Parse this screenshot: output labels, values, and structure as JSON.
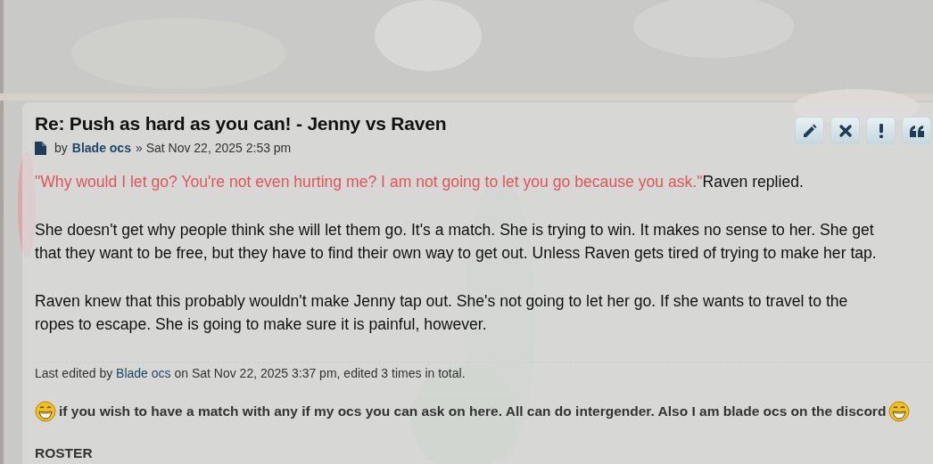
{
  "post": {
    "title": "Re: Push as hard as you can! - Jenny vs Raven",
    "meta": {
      "by": "by",
      "author": "Blade ocs",
      "sep": "»",
      "date": "Sat Nov 22, 2025 2:53 pm"
    },
    "actions": [
      {
        "kind": "edit"
      },
      {
        "kind": "delete"
      },
      {
        "kind": "report"
      },
      {
        "kind": "quote"
      }
    ],
    "quote": {
      "speech": "\"Why would I let go? You're not even hurting me? I am not going to let you go because you ask.\"",
      "after": "Raven replied."
    },
    "paragraphs": [
      {
        "lines": [
          "She doesn't get why people think she will let them go. It's a match. She is trying to win. It makes no sense to her. She get",
          "that they want to be free, but they have to find their own way to get out. Unless Raven gets tired of trying to make her tap."
        ]
      },
      {
        "lines": [
          "Raven knew that this probably wouldn't make Jenny tap out. She's not going to let her go. If she wants to travel to the",
          "ropes to escape. She is going to make sure it is painful, however."
        ]
      }
    ],
    "edited": {
      "prefix": "Last edited by",
      "author": "Blade ocs",
      "suffix": "on Sat Nov 22, 2025 3:37 pm, edited 3 times in total."
    },
    "signature": {
      "text": "if you wish to have a match with any if my ocs you can ask on here. All can do intergender. Also I am blade ocs on the discord",
      "heading": "ROSTER"
    }
  }
}
